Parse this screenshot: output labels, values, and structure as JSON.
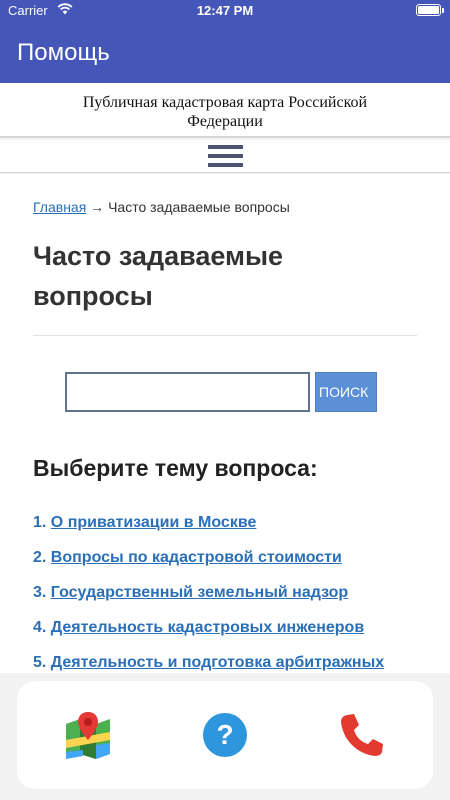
{
  "status_bar": {
    "carrier": "Carrier",
    "time": "12:47 PM"
  },
  "app_bar": {
    "title": "Помощь"
  },
  "site_header": {
    "title": "Публичная кадастровая карта Российской Федерации"
  },
  "breadcrumb": {
    "home": "Главная",
    "separator": " → ",
    "current": "Часто задаваемые вопросы"
  },
  "page": {
    "title": "Часто задаваемые вопросы"
  },
  "search": {
    "value": "",
    "placeholder": "",
    "button_label": "ПОИСК"
  },
  "topics": {
    "heading": "Выберите тему вопроса:",
    "items": [
      {
        "number": "1. ",
        "label": "О приватизации в Москве"
      },
      {
        "number": "2. ",
        "label": "Вопросы по кадастровой стоимости"
      },
      {
        "number": "3. ",
        "label": "Государственный земельный надзор"
      },
      {
        "number": "4. ",
        "label": "Деятельность кадастровых инженеров"
      },
      {
        "number": "5. ",
        "label": "Деятельность и подготовка арбитражных"
      }
    ]
  },
  "bottom_nav": {
    "icons": [
      "map-icon",
      "help-icon",
      "phone-icon"
    ]
  },
  "colors": {
    "accent": "#4457b8",
    "link": "#2a6fb7",
    "search_button": "#5b8fd6",
    "help": "#2d96dc",
    "phone": "#e23a2f"
  }
}
